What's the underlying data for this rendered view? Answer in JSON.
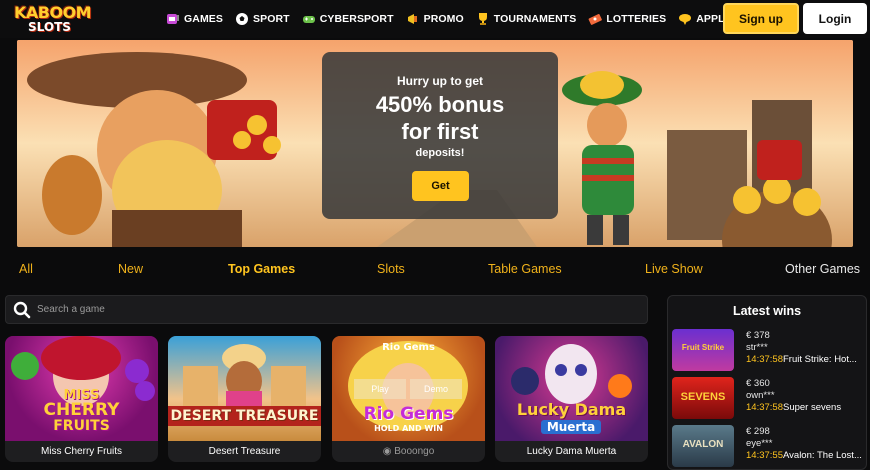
{
  "brand": {
    "logo_top": "KABOOM",
    "logo_bottom": "SLOTS"
  },
  "nav": [
    {
      "label": "GAMES",
      "icon": "slot-machine-icon"
    },
    {
      "label": "SPORT",
      "icon": "soccer-ball-icon"
    },
    {
      "label": "CYBERSPORT",
      "icon": "gamepad-icon"
    },
    {
      "label": "PROMO",
      "icon": "megaphone-icon"
    },
    {
      "label": "TOURNAMENTS",
      "icon": "trophy-icon"
    },
    {
      "label": "LOTTERIES",
      "icon": "ticket-icon"
    },
    {
      "label": "APPLICATION",
      "icon": "cloud-download-icon"
    }
  ],
  "auth": {
    "signup": "Sign up",
    "login": "Login"
  },
  "banner": {
    "line1": "Hurry up to get",
    "line2": "450% bonus",
    "line3": "for first",
    "line4": "deposits!",
    "cta": "Get",
    "slides": 8,
    "active_slide": 0
  },
  "tabs": [
    {
      "label": "All"
    },
    {
      "label": "New"
    },
    {
      "label": "Top Games",
      "active": true
    },
    {
      "label": "Slots"
    },
    {
      "label": "Table Games"
    },
    {
      "label": "Live Show"
    },
    {
      "label": "Other Games"
    }
  ],
  "search": {
    "placeholder": "Search a game"
  },
  "games": [
    {
      "name": "Miss Cherry Fruits",
      "art": [
        "MISS",
        "CHERRY",
        "FRUITS"
      ]
    },
    {
      "name": "Desert Treasure",
      "art": [
        "DESERT TREASURE"
      ]
    },
    {
      "name": "",
      "art": [
        "Rio Gems",
        "HOLD AND WIN"
      ],
      "badge": "Rio Gems",
      "provider": "Booongo",
      "play": "Play",
      "demo": "Demo"
    },
    {
      "name": "Lucky Dama Muerta",
      "art": [
        "Lucky Dama",
        "Muerta"
      ]
    }
  ],
  "latest_wins": {
    "title": "Latest wins",
    "items": [
      {
        "amount": "€ 378",
        "user": "str***",
        "time": "14:37:58",
        "game": "Fruit Strike: Hot...",
        "thumb_text": "Fruit Strike"
      },
      {
        "amount": "€ 360",
        "user": "own***",
        "time": "14:37:58",
        "game": "Super sevens",
        "thumb_text": "SEVENS"
      },
      {
        "amount": "€ 298",
        "user": "eye***",
        "time": "14:37:55",
        "game": "Avalon: The Lost...",
        "thumb_text": "AVALON"
      }
    ]
  },
  "colors": {
    "accent": "#ffc41f",
    "bg": "#0b0b0c",
    "panel": "#1b1b1d"
  }
}
